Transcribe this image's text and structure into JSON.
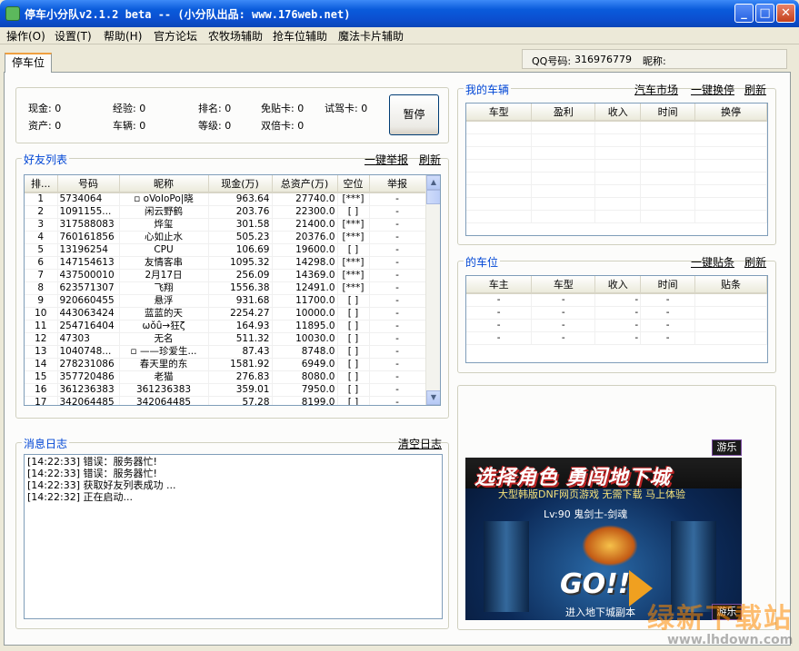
{
  "window": {
    "title": "停车小分队v2.1.2 beta -- (小分队出品: www.176web.net)",
    "minimize_icon": "minimize-icon",
    "maximize_icon": "maximize-icon",
    "close_icon": "close-icon"
  },
  "menu": [
    "操作(O)",
    "设置(T)",
    "帮助(H)",
    "官方论坛",
    "农牧场辅助",
    "抢车位辅助",
    "魔法卡片辅助"
  ],
  "tab": "停车位",
  "account": {
    "qq_label": "QQ号码:",
    "qq_value": "316976779",
    "nick_label": "昵称:"
  },
  "stats": {
    "cash": "现金: 0",
    "assets": "资产: 0",
    "exp": "经验: 0",
    "cars": "车辆: 0",
    "rank": "排名: 0",
    "level": "等级: 0",
    "free_card": "免贴卡: 0",
    "double_card": "双倍卡: 0",
    "trial_card": "试驾卡: 0"
  },
  "pause_label": "暂停",
  "friends": {
    "label": "好友列表",
    "report_all": "一键举报",
    "refresh": "刷新",
    "columns": [
      "排...",
      "号码",
      "昵称",
      "现金(万)",
      "总资产(万)",
      "空位",
      "举报"
    ],
    "rows": [
      [
        "1",
        "5734064",
        "▫ oVoIoPo|晓",
        "963.64",
        "27740.0",
        "[***]",
        "-"
      ],
      [
        "2",
        "1091155...",
        "闲云野鹤",
        "203.76",
        "22300.0",
        "[   ]",
        "-"
      ],
      [
        "3",
        "317588083",
        "烨玺",
        "301.58",
        "21400.0",
        "[***]",
        "-"
      ],
      [
        "4",
        "760161856",
        "心如止水",
        "505.23",
        "20376.0",
        "[***]",
        "-"
      ],
      [
        "5",
        "13196254",
        "CPU",
        "106.69",
        "19600.0",
        "[   ]",
        "-"
      ],
      [
        "6",
        "147154613",
        "友情客串",
        "1095.32",
        "14298.0",
        "[***]",
        "-"
      ],
      [
        "7",
        "437500010",
        "2月17日",
        "256.09",
        "14369.0",
        "[***]",
        "-"
      ],
      [
        "8",
        "623571307",
        "飞翔",
        "1556.38",
        "12491.0",
        "[***]",
        "-"
      ],
      [
        "9",
        "920660455",
        "悬浮",
        "931.68",
        "11700.0",
        "[   ]",
        "-"
      ],
      [
        "10",
        "443063424",
        "蓝蓝的天",
        "2254.27",
        "10000.0",
        "[   ]",
        "-"
      ],
      [
        "11",
        "254716404",
        "ωǒǚ→狂ζ",
        "164.93",
        "11895.0",
        "[   ]",
        "-"
      ],
      [
        "12",
        "47303",
        "无名",
        "511.32",
        "10030.0",
        "[   ]",
        "-"
      ],
      [
        "13",
        "1040748...",
        "▫ ——珍爱生...",
        "87.43",
        "8748.0",
        "[   ]",
        "-"
      ],
      [
        "14",
        "278231086",
        "春天里的东",
        "1581.92",
        "6949.0",
        "[   ]",
        "-"
      ],
      [
        "15",
        "357720486",
        "老猫",
        "276.83",
        "8080.0",
        "[   ]",
        "-"
      ],
      [
        "16",
        "361236383",
        "361236383",
        "359.01",
        "7950.0",
        "[   ]",
        "-"
      ],
      [
        "17",
        "342064485",
        "342064485",
        "57.28",
        "8199.0",
        "[   ]",
        "-"
      ]
    ]
  },
  "my_cars": {
    "label": "我的车辆",
    "market": "汽车市场",
    "swap_all": "一键换停",
    "refresh": "刷新",
    "columns": [
      "车型",
      "盈利",
      "收入",
      "时间",
      "换停"
    ]
  },
  "my_spots": {
    "label": "的车位",
    "stick_all": "一键贴条",
    "refresh": "刷新",
    "columns": [
      "车主",
      "车型",
      "收入",
      "时间",
      "贴条"
    ],
    "rows": [
      [
        "-",
        "-",
        "-",
        "-",
        ""
      ],
      [
        "-",
        "-",
        "-",
        "-",
        ""
      ],
      [
        "-",
        "-",
        "-",
        "-",
        ""
      ],
      [
        "-",
        "-",
        "-",
        "-",
        ""
      ]
    ]
  },
  "log": {
    "label": "消息日志",
    "clear": "清空日志",
    "lines": [
      "[14:22:33] 错误：服务器忙!",
      "[14:22:33] 错误：服务器忙!",
      "[14:22:33] 获取好友列表成功 ...",
      "[14:22:32] 正在启动..."
    ]
  },
  "ad": {
    "tag_top": "游乐",
    "tag_bottom": "游乐",
    "title": "选择角色 勇闯地下城",
    "subtitle": "大型韩版DNF网页游戏 无需下载 马上体验",
    "level": "Lv:90 鬼剑士-剑魂",
    "go": "GO!!",
    "bottom": "进入地下城副本"
  },
  "watermark": {
    "text": "绿新下载站",
    "url": "www.lhdown.com"
  }
}
